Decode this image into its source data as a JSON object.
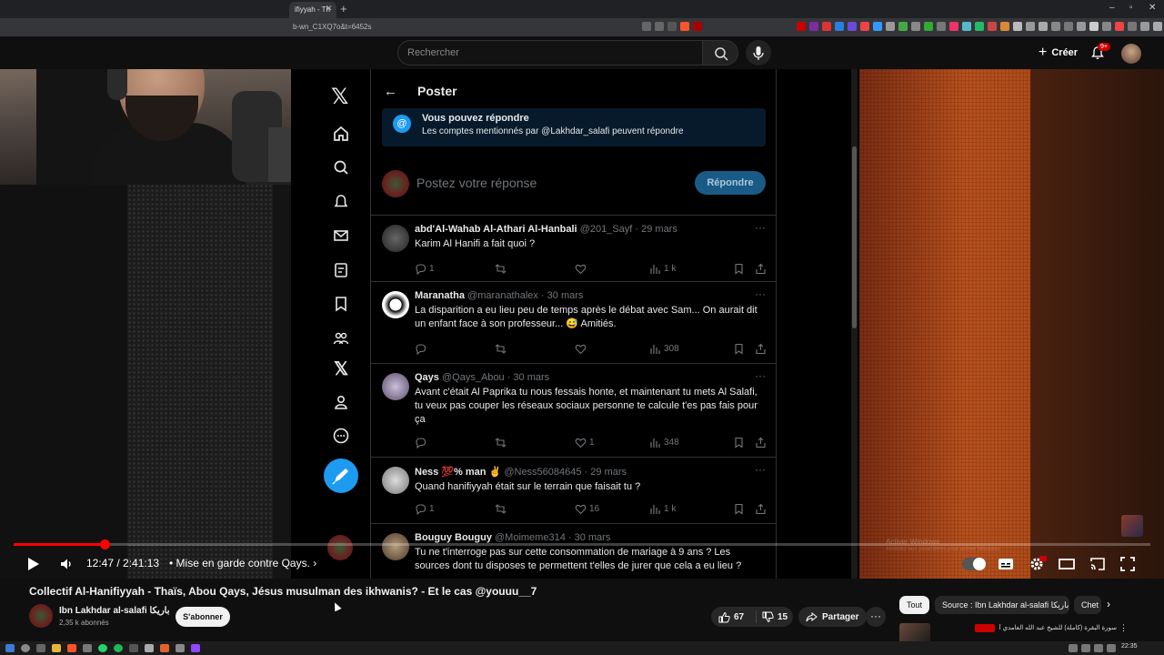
{
  "browser": {
    "tab_title": "ifiyyah - Th",
    "url": "b-wn_C1XQ7o&t=6452s"
  },
  "yt_header": {
    "search_placeholder": "Rechercher",
    "create_label": "Créer",
    "notif_badge": "9+"
  },
  "x_feed": {
    "logo": "𝕏",
    "page_title": "Poster",
    "notice_title": "Vous pouvez répondre",
    "notice_sub": "Les comptes mentionnés par @Lakhdar_salafi peuvent répondre",
    "reply_placeholder": "Postez votre réponse",
    "reply_button": "Répondre",
    "tweets": [
      {
        "name": "abd'Al-Wahab Al-Athari Al-Hanbali",
        "meta": "@201_Sayf · 29 mars",
        "text": "Karim Al Hanifi a fait quoi ?",
        "replies": "1",
        "likes": "",
        "views": "1 k"
      },
      {
        "name": "Maranatha",
        "meta": "@maranathalex · 30 mars",
        "text": "La disparition a eu lieu peu de temps après le débat avec Sam... On aurait dit un enfant face à son professeur... 😅 Amitiés.",
        "replies": "",
        "likes": "",
        "views": "308"
      },
      {
        "name": "Qays",
        "meta": "@Qays_Abou · 30 mars",
        "text": "Avant c'était Al Paprika tu nous fessais honte, et maintenant tu mets Al Salafi, tu veux pas couper les réseaux sociaux personne te calcule t'es pas fais pour ça",
        "replies": "",
        "likes": "1",
        "views": "348"
      },
      {
        "name": "Ness 💯% man ✌",
        "meta": "@Ness56084645 · 29 mars",
        "text": "Quand hanifiyyah était sur le terrain que faisait tu ?",
        "replies": "1",
        "likes": "16",
        "views": "1 k"
      },
      {
        "name": "Bouguy Bouguy",
        "meta": "@Moimeme314 · 30 mars",
        "text": "Tu ne t'interroge pas sur cette consommation de mariage à 9 ans ? Les sources dont tu disposes te permettent t'elles de jurer que cela a eu lieu ?",
        "replies": "",
        "likes": "",
        "views": ""
      }
    ]
  },
  "player": {
    "time": "12:47 / 2:41:13",
    "chapter": "• Mise en garde contre Qays.",
    "progress_fraction": 0.0793,
    "activate_windows": "Activer Windows",
    "activate_windows_sub": "Accédez aux paramètres pour activer Windows."
  },
  "video": {
    "title": "Collectif Al-Hanifiyyah - Thaïs, Abou Qays, Jésus musulman des ikhwanis? - Et le cas @youuu__7",
    "channel_name": "Ibn Lakhdar al-salafi باريكا",
    "subscribers": "2,35 k abonnés",
    "subscribe_label": "S'abonner",
    "likes": "67",
    "dislikes": "15",
    "share_label": "Partager"
  },
  "chips": [
    "Tout",
    "Source : Ibn Lakhdar al-salafi باريكا",
    "Chet"
  ],
  "recommendation": {
    "text": "سورة البقرة (كاملة) للشيخ عبد الله العامدي أجمل تلاوة"
  },
  "taskbar": {
    "clock": "22:35"
  },
  "colors": {
    "youtube_red": "#ff0000",
    "x_blue": "#1d9bf0",
    "background": "#0f0f0f"
  }
}
